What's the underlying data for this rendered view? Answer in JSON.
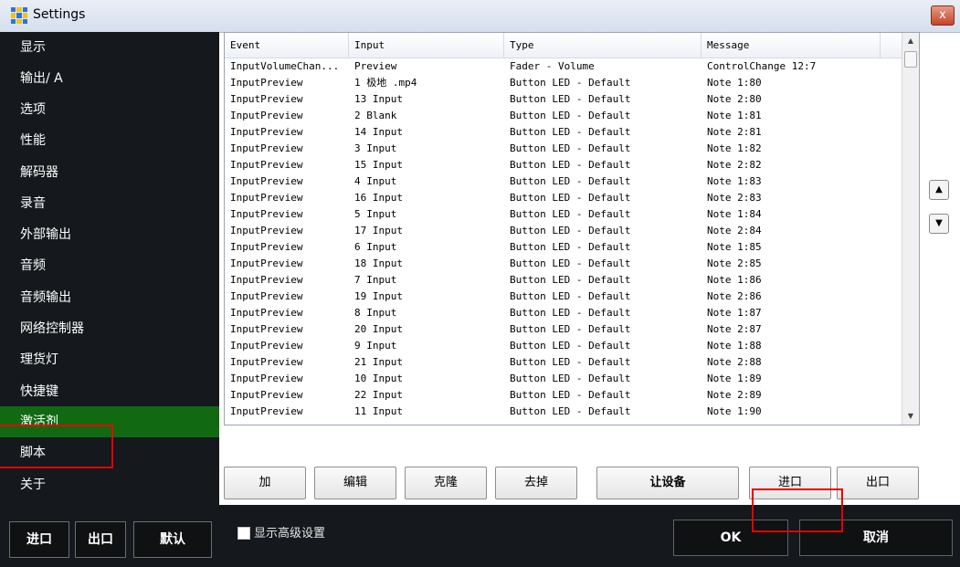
{
  "window": {
    "title": "Settings",
    "close_glyph": "x"
  },
  "sidebar": {
    "items": [
      {
        "label": "显示"
      },
      {
        "label": "输出/ A"
      },
      {
        "label": "选项"
      },
      {
        "label": "性能"
      },
      {
        "label": "解码器"
      },
      {
        "label": "录音"
      },
      {
        "label": "外部输出"
      },
      {
        "label": "音频"
      },
      {
        "label": "音频输出"
      },
      {
        "label": "网络控制器"
      },
      {
        "label": "理货灯"
      },
      {
        "label": "快捷键"
      },
      {
        "label": "激活剂",
        "active": true
      },
      {
        "label": "脚本"
      },
      {
        "label": "关于"
      }
    ],
    "buttons": {
      "import": "进口",
      "export": "出口",
      "default": "默认"
    }
  },
  "table": {
    "columns": [
      "Event",
      "Input",
      "Type",
      "Message"
    ],
    "rows": [
      [
        "InputVolumeChan...",
        "Preview",
        "Fader - Volume",
        "ControlChange 12:7"
      ],
      [
        "InputPreview",
        "1 极地 .mp4",
        "Button LED - Default",
        "Note 1:80"
      ],
      [
        "InputPreview",
        "13 Input",
        "Button LED - Default",
        "Note 2:80"
      ],
      [
        "InputPreview",
        "2 Blank",
        "Button LED - Default",
        "Note 1:81"
      ],
      [
        "InputPreview",
        "14 Input",
        "Button LED - Default",
        "Note 2:81"
      ],
      [
        "InputPreview",
        "3 Input",
        "Button LED - Default",
        "Note 1:82"
      ],
      [
        "InputPreview",
        "15 Input",
        "Button LED - Default",
        "Note 2:82"
      ],
      [
        "InputPreview",
        "4 Input",
        "Button LED - Default",
        "Note 1:83"
      ],
      [
        "InputPreview",
        "16 Input",
        "Button LED - Default",
        "Note 2:83"
      ],
      [
        "InputPreview",
        "5 Input",
        "Button LED - Default",
        "Note 1:84"
      ],
      [
        "InputPreview",
        "17 Input",
        "Button LED - Default",
        "Note 2:84"
      ],
      [
        "InputPreview",
        "6 Input",
        "Button LED - Default",
        "Note 1:85"
      ],
      [
        "InputPreview",
        "18 Input",
        "Button LED - Default",
        "Note 2:85"
      ],
      [
        "InputPreview",
        "7 Input",
        "Button LED - Default",
        "Note 1:86"
      ],
      [
        "InputPreview",
        "19 Input",
        "Button LED - Default",
        "Note 2:86"
      ],
      [
        "InputPreview",
        "8 Input",
        "Button LED - Default",
        "Note 1:87"
      ],
      [
        "InputPreview",
        "20 Input",
        "Button LED - Default",
        "Note 2:87"
      ],
      [
        "InputPreview",
        "9 Input",
        "Button LED - Default",
        "Note 1:88"
      ],
      [
        "InputPreview",
        "21 Input",
        "Button LED - Default",
        "Note 2:88"
      ],
      [
        "InputPreview",
        "10 Input",
        "Button LED - Default",
        "Note 1:89"
      ],
      [
        "InputPreview",
        "22 Input",
        "Button LED - Default",
        "Note 2:89"
      ],
      [
        "InputPreview",
        "11 Input",
        "Button LED - Default",
        "Note 1:90"
      ]
    ]
  },
  "reorder": {
    "up_glyph": "▲",
    "down_glyph": "▼"
  },
  "actions": {
    "add": "加",
    "edit": "编辑",
    "clone": "克隆",
    "remove": "去掉",
    "device": "让设备",
    "import": "进口",
    "export": "出口"
  },
  "footer": {
    "advanced_label": "显示高级设置",
    "advanced_checked": false,
    "ok": "OK",
    "cancel": "取消"
  },
  "colors": {
    "sidebar_bg": "#15181c",
    "active_item": "#116a12",
    "annotation": "#e60000"
  },
  "icons": {
    "app": "grid-app-icon",
    "close": "close-icon",
    "up": "arrow-up-icon",
    "down": "arrow-down-icon"
  }
}
